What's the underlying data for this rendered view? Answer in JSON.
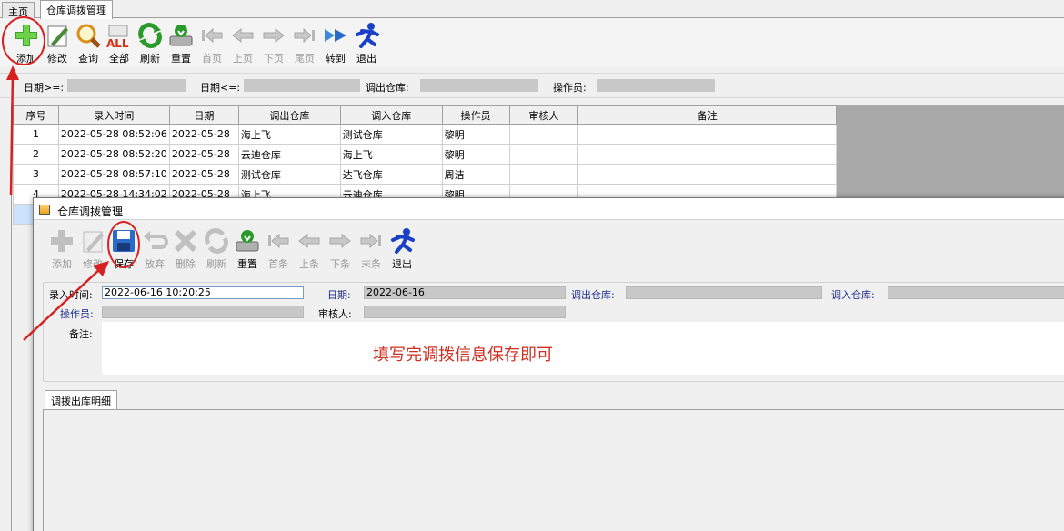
{
  "tabs": [
    {
      "label": "主页"
    },
    {
      "label": "仓库调拨管理"
    }
  ],
  "toolbar": [
    {
      "label": "添加",
      "icon": "add-icon",
      "enabled": true
    },
    {
      "label": "修改",
      "icon": "edit-icon",
      "enabled": true
    },
    {
      "label": "查询",
      "icon": "search-icon",
      "enabled": true
    },
    {
      "label": "全部",
      "icon": "all-icon",
      "enabled": true
    },
    {
      "label": "刷新",
      "icon": "refresh-icon",
      "enabled": true
    },
    {
      "label": "重置",
      "icon": "reset-icon",
      "enabled": true
    },
    {
      "label": "首页",
      "icon": "first-page-icon",
      "enabled": false
    },
    {
      "label": "上页",
      "icon": "prev-page-icon",
      "enabled": false
    },
    {
      "label": "下页",
      "icon": "next-page-icon",
      "enabled": false
    },
    {
      "label": "尾页",
      "icon": "last-page-icon",
      "enabled": false
    },
    {
      "label": "转到",
      "icon": "goto-icon",
      "enabled": true
    },
    {
      "label": "退出",
      "icon": "exit-icon",
      "enabled": true
    }
  ],
  "filters": {
    "date_from": "日期>=:",
    "date_to": "日期<=:",
    "out_warehouse": "调出仓库:",
    "operator": "操作员:"
  },
  "grid": {
    "columns": [
      "序号",
      "录入时间",
      "日期",
      "调出仓库",
      "调入仓库",
      "操作员",
      "审核人",
      "备注"
    ],
    "rows": [
      [
        "1",
        "2022-05-28 08:52:06",
        "2022-05-28",
        "海上飞",
        "测试仓库",
        "黎明",
        "",
        ""
      ],
      [
        "2",
        "2022-05-28 08:52:20",
        "2022-05-28",
        "云迪仓库",
        "海上飞",
        "黎明",
        "",
        ""
      ],
      [
        "3",
        "2022-05-28 08:57:10",
        "2022-05-28",
        "测试仓库",
        "达飞仓库",
        "周洁",
        "",
        ""
      ],
      [
        "4",
        "2022-05-28 14:34:02",
        "2022-05-28",
        "海上飞",
        "云迪仓库",
        "黎明",
        "",
        ""
      ]
    ]
  },
  "dialog": {
    "title": "仓库调拨管理",
    "toolbar": [
      {
        "label": "添加",
        "icon": "add-icon",
        "enabled": false
      },
      {
        "label": "修改",
        "icon": "edit-icon",
        "enabled": false
      },
      {
        "label": "保存",
        "icon": "save-icon",
        "enabled": true
      },
      {
        "label": "放弃",
        "icon": "undo-icon",
        "enabled": false
      },
      {
        "label": "删除",
        "icon": "delete-icon",
        "enabled": false
      },
      {
        "label": "刷新",
        "icon": "refresh-icon",
        "enabled": false
      },
      {
        "label": "重置",
        "icon": "reset-icon",
        "enabled": true
      },
      {
        "label": "首条",
        "icon": "first-page-icon",
        "enabled": false
      },
      {
        "label": "上条",
        "icon": "prev-page-icon",
        "enabled": false
      },
      {
        "label": "下条",
        "icon": "next-page-icon",
        "enabled": false
      },
      {
        "label": "末条",
        "icon": "last-page-icon",
        "enabled": false
      },
      {
        "label": "退出",
        "icon": "exit-icon",
        "enabled": true
      }
    ],
    "form": {
      "entry_time_label": "录入时间:",
      "entry_time_value": "2022-06-16 10:20:25",
      "date_label": "日期:",
      "date_value": "2022-06-16",
      "out_warehouse_label": "调出仓库:",
      "in_warehouse_label": "调入仓库:",
      "operator_label": "操作员:",
      "reviewer_label": "审核人:",
      "remarks_label": "备注:"
    },
    "annotation": "填写完调拨信息保存即可",
    "detail_tab": "调拨出库明细"
  },
  "colors": {
    "annotation": "#d03020",
    "selected_row": "#cbe3fb",
    "label_blue": "#1a2a8a"
  }
}
